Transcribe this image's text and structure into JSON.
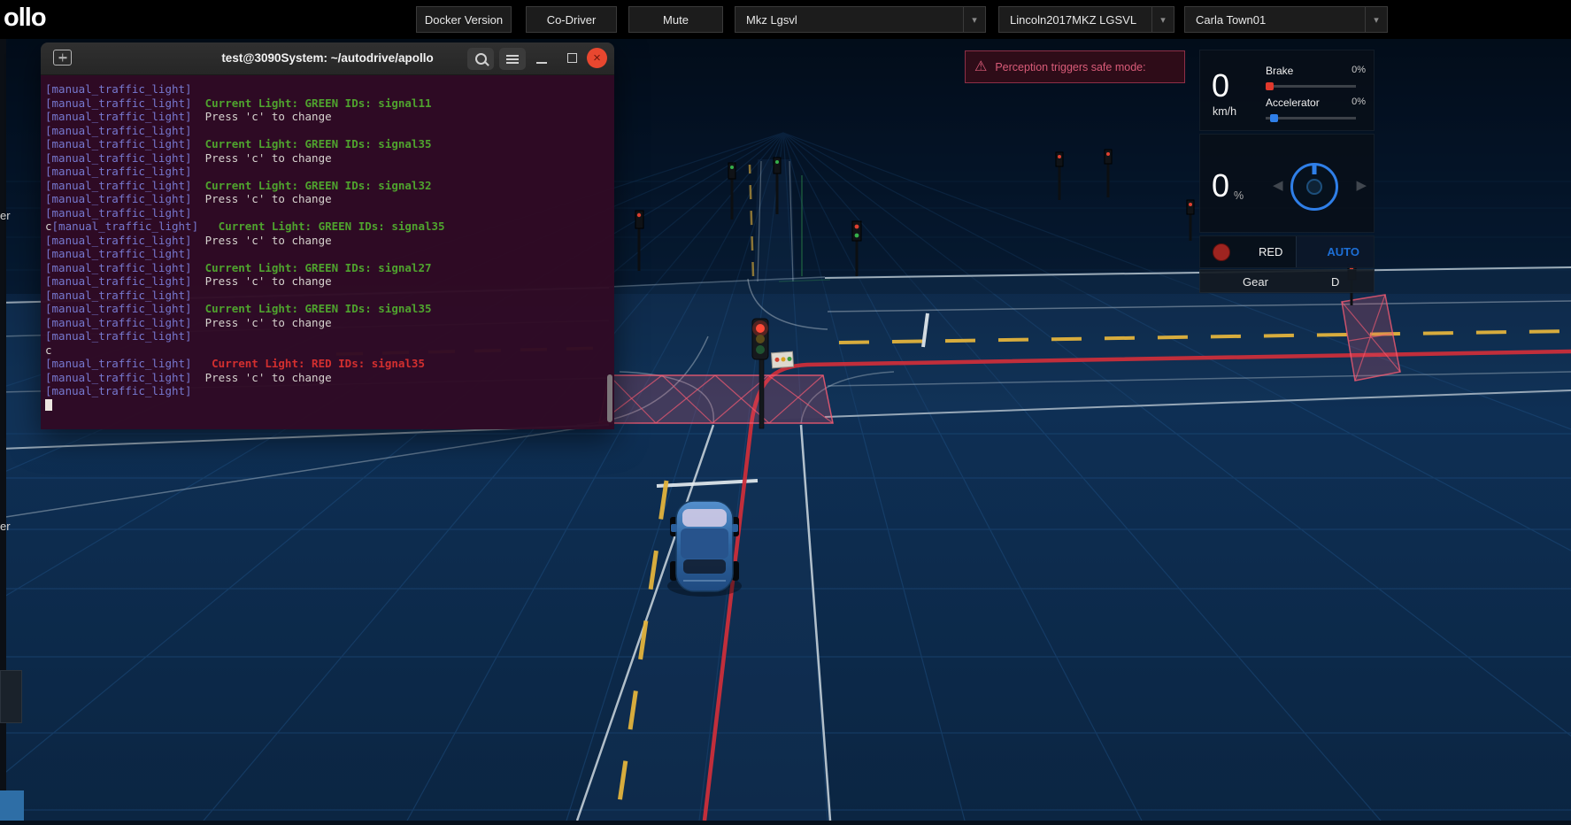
{
  "topbar": {
    "logo": "ollo",
    "buttons": [
      {
        "label": "Docker Version"
      },
      {
        "label": "Co-Driver"
      },
      {
        "label": "Mute"
      }
    ],
    "dropdowns": [
      {
        "value": "Mkz Lgsvl"
      },
      {
        "value": "Lincoln2017MKZ LGSVL"
      },
      {
        "value": "Carla Town01"
      }
    ]
  },
  "terminal": {
    "title": "test@3090System: ~/autodrive/apollo",
    "lines": [
      {
        "prefix": "[manual_traffic_light]"
      },
      {
        "prefix": "[manual_traffic_light]",
        "msg": "  Current Light: GREEN IDs: signal11",
        "type": "green"
      },
      {
        "prefix": "[manual_traffic_light]",
        "msg": "  Press 'c' to change"
      },
      {
        "prefix": "[manual_traffic_light]"
      },
      {
        "prefix": "[manual_traffic_light]",
        "msg": "  Current Light: GREEN IDs: signal35",
        "type": "green"
      },
      {
        "prefix": "[manual_traffic_light]",
        "msg": "  Press 'c' to change"
      },
      {
        "prefix": "[manual_traffic_light]"
      },
      {
        "prefix": "[manual_traffic_light]",
        "msg": "  Current Light: GREEN IDs: signal32",
        "type": "green"
      },
      {
        "prefix": "[manual_traffic_light]",
        "msg": "  Press 'c' to change"
      },
      {
        "prefix": "[manual_traffic_light]"
      },
      {
        "lead": "c",
        "prefix": "[manual_traffic_light]",
        "msg": "   Current Light: GREEN IDs: signal35",
        "type": "green"
      },
      {
        "prefix": "[manual_traffic_light]",
        "msg": "  Press 'c' to change"
      },
      {
        "prefix": "[manual_traffic_light]"
      },
      {
        "prefix": "[manual_traffic_light]",
        "msg": "  Current Light: GREEN IDs: signal27",
        "type": "green"
      },
      {
        "prefix": "[manual_traffic_light]",
        "msg": "  Press 'c' to change"
      },
      {
        "prefix": "[manual_traffic_light]"
      },
      {
        "prefix": "[manual_traffic_light]",
        "msg": "  Current Light: GREEN IDs: signal35",
        "type": "green"
      },
      {
        "prefix": "[manual_traffic_light]",
        "msg": "  Press 'c' to change"
      },
      {
        "prefix": "[manual_traffic_light]"
      },
      {
        "lead": "c"
      },
      {
        "prefix": "[manual_traffic_light]",
        "msg": "   Current Light: RED IDs: signal35",
        "type": "red"
      },
      {
        "prefix": "[manual_traffic_light]",
        "msg": "  Press 'c' to change"
      },
      {
        "prefix": "[manual_traffic_light]"
      },
      {
        "cursor": true
      }
    ]
  },
  "warning": {
    "text": "Perception triggers safe mode:"
  },
  "dashboard": {
    "speed": {
      "value": "0",
      "unit": "km/h"
    },
    "brake": {
      "label": "Brake",
      "value": "0%"
    },
    "accelerator": {
      "label": "Accelerator",
      "value": "0%"
    },
    "steering": {
      "value": "0",
      "unit": "%"
    },
    "signal": {
      "label": "RED"
    },
    "mode": {
      "label": "AUTO"
    },
    "gear": {
      "label": "Gear",
      "value": "D"
    }
  },
  "scene": {
    "fragments": [
      "er",
      "er"
    ]
  },
  "icons": {
    "dropdown_chevron": "▾",
    "close": "×",
    "warning": "⚠",
    "left_arrow": "◀",
    "right_arrow": "▶"
  },
  "colors": {
    "accent_blue": "#2f7fe8",
    "warning_pink": "#d85b78",
    "route_red": "#cb2e3a",
    "signal_red": "#9e2420",
    "terminal_bg": "#300a24",
    "terminal_green": "#4fa32e",
    "terminal_red": "#d22f2f",
    "terminal_prefix_blue": "#7678cf"
  }
}
